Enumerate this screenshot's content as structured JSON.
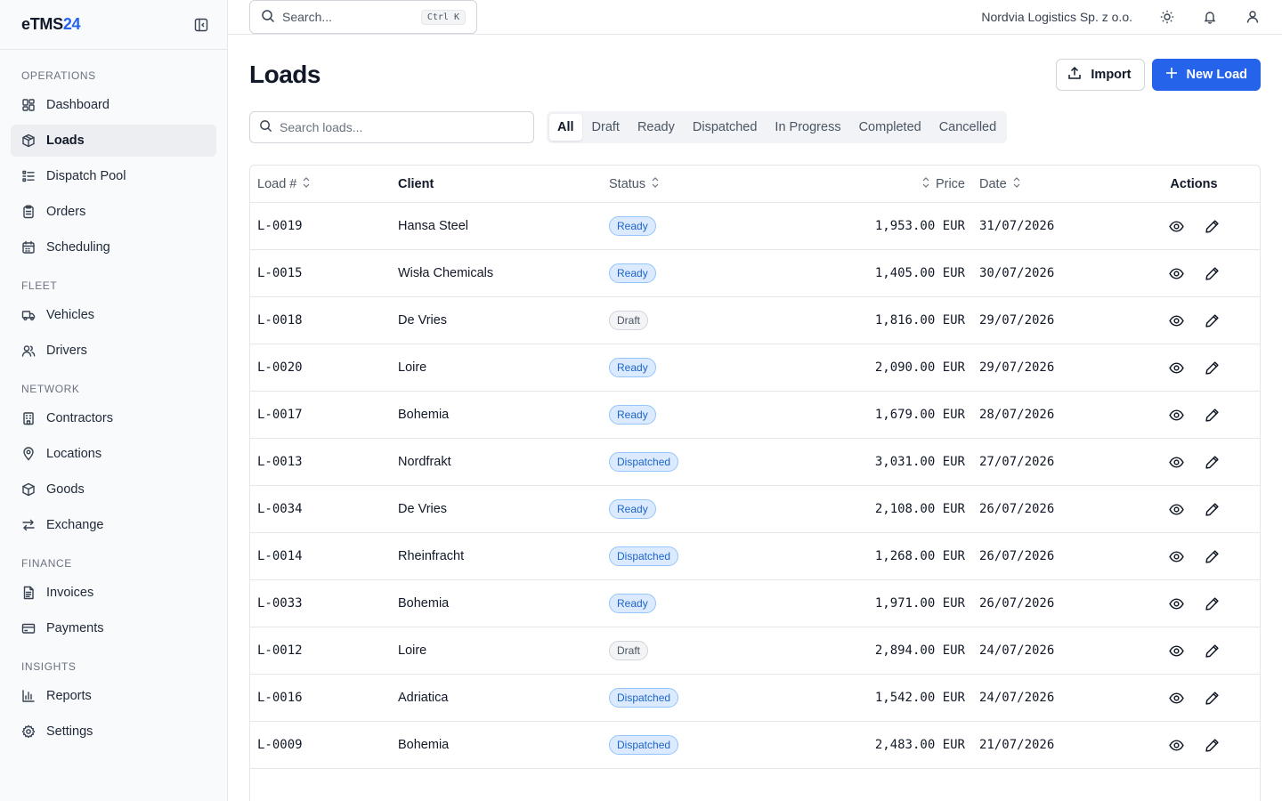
{
  "brand": {
    "name": "eTMS",
    "suffix": "24"
  },
  "sidebar": {
    "sections": [
      {
        "title": "OPERATIONS",
        "items": [
          {
            "label": "Dashboard",
            "icon": "grid-icon",
            "active": false
          },
          {
            "label": "Loads",
            "icon": "package-icon",
            "active": true
          },
          {
            "label": "Dispatch Pool",
            "icon": "list-icon",
            "active": false
          },
          {
            "label": "Orders",
            "icon": "clipboard-icon",
            "active": false
          },
          {
            "label": "Scheduling",
            "icon": "calendar-icon",
            "active": false
          }
        ]
      },
      {
        "title": "FLEET",
        "items": [
          {
            "label": "Vehicles",
            "icon": "truck-icon",
            "active": false
          },
          {
            "label": "Drivers",
            "icon": "users-icon",
            "active": false
          }
        ]
      },
      {
        "title": "NETWORK",
        "items": [
          {
            "label": "Contractors",
            "icon": "building-icon",
            "active": false
          },
          {
            "label": "Locations",
            "icon": "map-pin-icon",
            "active": false
          },
          {
            "label": "Goods",
            "icon": "box-icon",
            "active": false
          },
          {
            "label": "Exchange",
            "icon": "exchange-icon",
            "active": false
          }
        ]
      },
      {
        "title": "FINANCE",
        "items": [
          {
            "label": "Invoices",
            "icon": "file-text-icon",
            "active": false
          },
          {
            "label": "Payments",
            "icon": "credit-card-icon",
            "active": false
          }
        ]
      },
      {
        "title": "INSIGHTS",
        "items": [
          {
            "label": "Reports",
            "icon": "bar-chart-icon",
            "active": false
          },
          {
            "label": "Settings",
            "icon": "gear-icon",
            "active": false
          }
        ]
      }
    ]
  },
  "topbar": {
    "search_placeholder": "Search...",
    "shortcut": "Ctrl K",
    "company": "Nordvia Logistics Sp. z o.o."
  },
  "page": {
    "title": "Loads",
    "import_label": "Import",
    "new_label": "New Load",
    "search_placeholder": "Search loads...",
    "tabs": [
      "All",
      "Draft",
      "Ready",
      "Dispatched",
      "In Progress",
      "Completed",
      "Cancelled"
    ],
    "active_tab": "All"
  },
  "table": {
    "headers": {
      "load": "Load #",
      "client": "Client",
      "status": "Status",
      "price": "Price",
      "date": "Date",
      "actions": "Actions"
    },
    "rows": [
      {
        "id": "L-0019",
        "client": "Hansa Steel",
        "status": "Ready",
        "price": "1,953.00 EUR",
        "date": "31/07/2026"
      },
      {
        "id": "L-0015",
        "client": "Wisła Chemicals",
        "status": "Ready",
        "price": "1,405.00 EUR",
        "date": "30/07/2026"
      },
      {
        "id": "L-0018",
        "client": "De Vries",
        "status": "Draft",
        "price": "1,816.00 EUR",
        "date": "29/07/2026"
      },
      {
        "id": "L-0020",
        "client": "Loire",
        "status": "Ready",
        "price": "2,090.00 EUR",
        "date": "29/07/2026"
      },
      {
        "id": "L-0017",
        "client": "Bohemia",
        "status": "Ready",
        "price": "1,679.00 EUR",
        "date": "28/07/2026"
      },
      {
        "id": "L-0013",
        "client": "Nordfrakt",
        "status": "Dispatched",
        "price": "3,031.00 EUR",
        "date": "27/07/2026"
      },
      {
        "id": "L-0034",
        "client": "De Vries",
        "status": "Ready",
        "price": "2,108.00 EUR",
        "date": "26/07/2026"
      },
      {
        "id": "L-0014",
        "client": "Rheinfracht",
        "status": "Dispatched",
        "price": "1,268.00 EUR",
        "date": "26/07/2026"
      },
      {
        "id": "L-0033",
        "client": "Bohemia",
        "status": "Ready",
        "price": "1,971.00 EUR",
        "date": "26/07/2026"
      },
      {
        "id": "L-0012",
        "client": "Loire",
        "status": "Draft",
        "price": "2,894.00 EUR",
        "date": "24/07/2026"
      },
      {
        "id": "L-0016",
        "client": "Adriatica",
        "status": "Dispatched",
        "price": "1,542.00 EUR",
        "date": "24/07/2026"
      },
      {
        "id": "L-0009",
        "client": "Bohemia",
        "status": "Dispatched",
        "price": "2,483.00 EUR",
        "date": "21/07/2026"
      }
    ]
  },
  "colors": {
    "accent": "#2563eb",
    "badge_blue_bg": "#dbeafe",
    "badge_blue_text": "#1e64c8",
    "sidebar_bg": "#f8fafc"
  }
}
